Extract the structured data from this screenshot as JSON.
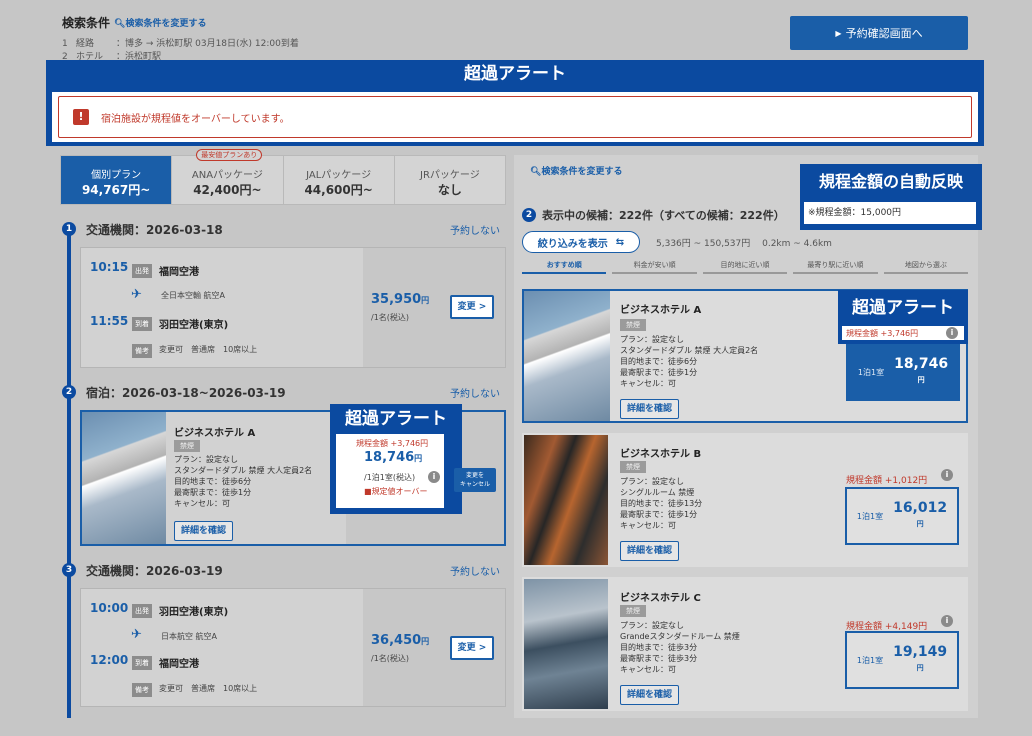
{
  "header": {
    "title": "検索条件",
    "change_link": "検索条件を変更する",
    "rows": [
      {
        "num": "1",
        "key": "経路",
        "value": "：博多 → 浜松町駅 03月18日(水) 12:00到着"
      },
      {
        "num": "2",
        "key": "ホテル",
        "value": "：浜松町駅"
      }
    ],
    "confirm_button": "予約確認画面へ"
  },
  "alert": {
    "heading": "超過アラート",
    "icon": "!",
    "message": "宿泊施設が規程値をオーバーしています。"
  },
  "plan_tabs": [
    {
      "name": "個別プラン",
      "value": "94,767円~",
      "active": true,
      "badge": ""
    },
    {
      "name": "ANAパッケージ",
      "value": "42,400円~",
      "active": false,
      "badge": "最安値プランあり"
    },
    {
      "name": "JALパッケージ",
      "value": "44,600円~",
      "active": false,
      "badge": ""
    },
    {
      "name": "JRパッケージ",
      "value": "なし",
      "active": false,
      "badge": ""
    }
  ],
  "steps": [
    {
      "num": "1",
      "title": "交通機関：2026-03-18",
      "skip": "予約しない",
      "dep_time": "10:15",
      "dep_label": "出発",
      "dep_place": "福岡空港",
      "airline": "全日本空輸 航空A",
      "arr_time": "11:55",
      "arr_label": "到着",
      "arr_place": "羽田空港(東京)",
      "note_label": "備考",
      "note": "変更可　普通席　10席以上",
      "price": "35,950",
      "price_unit": "円",
      "per": "/1名(税込)",
      "change_button": "変更 >"
    },
    {
      "num": "2",
      "title": "宿泊：2026-03-18~2026-03-19",
      "skip": "予約しない",
      "hotel_name": "ビジネスホテル A",
      "hotel_badge": "禁煙",
      "lines": [
        "プラン：設定なし",
        "スタンダードダブル 禁煙 大人定員2名",
        "目的地まで：徒歩6分",
        "最寄駅まで：徒歩1分",
        "キャンセル：可"
      ],
      "detail_button": "詳細を確認",
      "over_label": "超過アラート",
      "rule_text": "規程金額 +3,746円",
      "price": "18,746",
      "price_unit": "円",
      "per": "/1泊1室(税込)",
      "over_warning": "規定値オーバー",
      "cancel_button_l1": "変更を",
      "cancel_button_l2": "キャンセル"
    },
    {
      "num": "3",
      "title": "交通機関：2026-03-19",
      "skip": "予約しない",
      "dep_time": "10:00",
      "dep_label": "出発",
      "dep_place": "羽田空港(東京)",
      "airline": "日本航空 航空A",
      "arr_time": "12:00",
      "arr_label": "到着",
      "arr_place": "福岡空港",
      "note_label": "備考",
      "note": "変更可　普通席　10席以上",
      "price": "36,450",
      "price_unit": "円",
      "per": "/1名(税込)",
      "change_button": "変更 >"
    }
  ],
  "right": {
    "change_link": "検索条件を変更する",
    "auto_reflect_label": "規程金額の自動反映",
    "rule_amount": "※規程金額：15,000円",
    "step_num": "2",
    "count_text": "表示中の候補：222件（すべての候補：222件）",
    "filter_button": "絞り込みを表示",
    "range": "5,336円 ~ 150,537円　 0.2km ~ 4.6km",
    "sorts": [
      {
        "label": "おすすめ順",
        "active": true
      },
      {
        "label": "料金が安い順",
        "active": false
      },
      {
        "label": "目的地に近い順",
        "active": false
      },
      {
        "label": "最寄り駅に近い順",
        "active": false
      },
      {
        "label": "地図から選ぶ",
        "active": false
      }
    ],
    "hotels": [
      {
        "name": "ビジネスホテル A",
        "badge": "禁煙",
        "lines": [
          "プラン：設定なし",
          "スタンダードダブル 禁煙 大人定員2名",
          "目的地まで：徒歩6分",
          "最寄駅まで：徒歩1分",
          "キャンセル：可"
        ],
        "detail": "詳細を確認",
        "over_label": "超過アラート",
        "rule_text": "規程金額 +3,746円",
        "pb_label": "1泊1室",
        "pb_value": "18,746",
        "pb_unit": "円"
      },
      {
        "name": "ビジネスホテル B",
        "badge": "禁煙",
        "lines": [
          "プラン：設定なし",
          "シングルルーム 禁煙",
          "目的地まで：徒歩13分",
          "最寄駅まで：徒歩1分",
          "キャンセル：可"
        ],
        "detail": "詳細を確認",
        "rule_text": "規程金額 +1,012円",
        "pb_label": "1泊1室",
        "pb_value": "16,012",
        "pb_unit": "円"
      },
      {
        "name": "ビジネスホテル C",
        "badge": "禁煙",
        "lines": [
          "プラン：設定なし",
          "Grandeスタンダードルーム 禁煙",
          "目的地まで：徒歩3分",
          "最寄駅まで：徒歩3分",
          "キャンセル：可"
        ],
        "detail": "詳細を確認",
        "rule_text": "規程金額 +4,149円",
        "pb_label": "1泊1室",
        "pb_value": "19,149",
        "pb_unit": "円"
      }
    ]
  }
}
